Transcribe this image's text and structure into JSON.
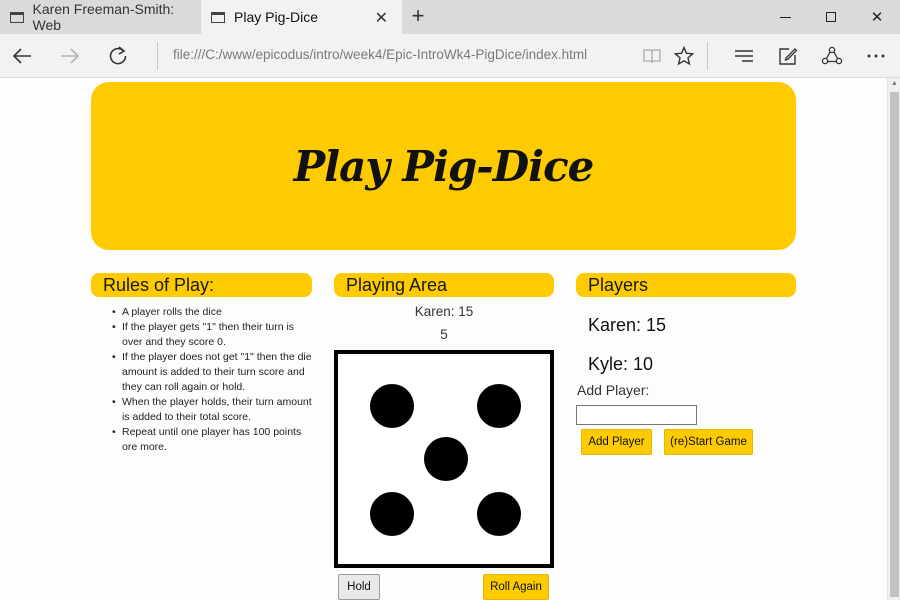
{
  "browser": {
    "tabs": [
      {
        "title": "Karen Freeman-Smith: Web",
        "active": false
      },
      {
        "title": "Play Pig-Dice",
        "active": true
      }
    ],
    "url": "file:///C:/www/epicodus/intro/week4/Epic-IntroWk4-PigDice/index.html",
    "icons": {
      "back": "back-arrow-icon",
      "forward": "forward-arrow-icon",
      "refresh": "refresh-icon",
      "reading_view": "book-icon",
      "favorite": "star-icon",
      "hub": "hub-icon",
      "notes": "pen-note-icon",
      "share": "share-icon",
      "more": "ellipsis-icon"
    }
  },
  "page": {
    "title": "Play Pig-Dice",
    "accent_color": "#fdcb00",
    "rules": {
      "heading": "Rules of Play:",
      "items": [
        "A player rolls the dice",
        "If the player gets \"1\" then their turn is over and they score 0.",
        "If the player does not get \"1\" then the die amount is added to their turn score and they can roll again or hold.",
        "When the player holds, their turn amount is added to their total score.",
        "Repeat until one player has 100 points ore more."
      ]
    },
    "playing_area": {
      "heading": "Playing Area",
      "current_turn": "Karen: 15",
      "last_roll": "5",
      "die_value": 5,
      "hold_label": "Hold",
      "roll_label": "Roll Again"
    },
    "players": {
      "heading": "Players",
      "list": [
        "Karen: 15",
        "Kyle: 10"
      ],
      "add_label": "Add Player:",
      "add_input_value": "",
      "add_button": "Add Player",
      "restart_button": "(re)Start Game"
    }
  }
}
